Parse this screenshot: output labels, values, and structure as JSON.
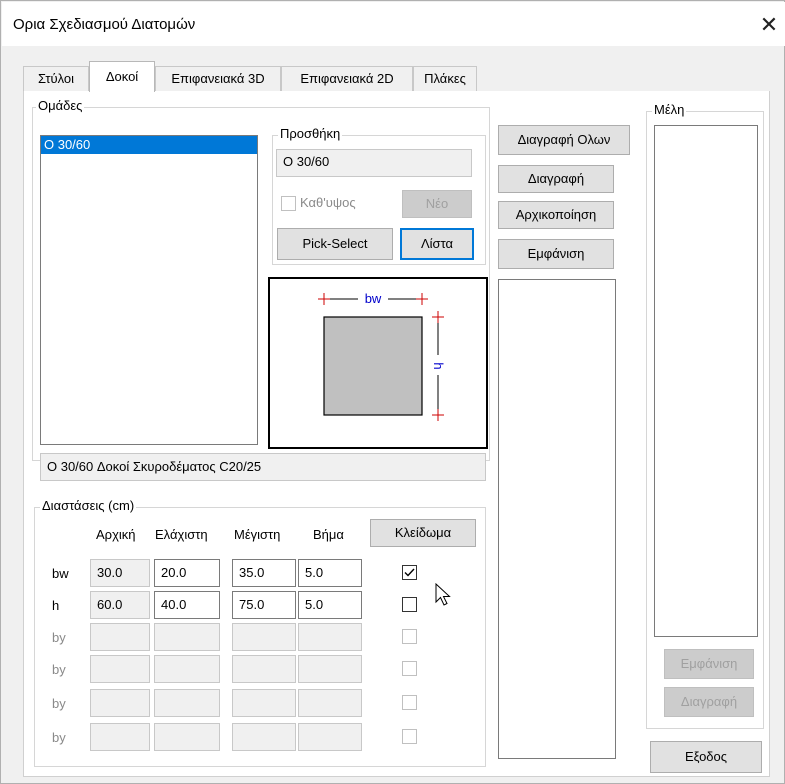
{
  "window": {
    "title": "Ορια Σχεδιασμού Διατομών",
    "close_glyph": "✕"
  },
  "tabs": [
    {
      "label": "Στύλοι",
      "active": false
    },
    {
      "label": "Δοκοί",
      "active": true
    },
    {
      "label": "Επιφανειακά 3D",
      "active": false
    },
    {
      "label": "Επιφανειακά 2D",
      "active": false
    },
    {
      "label": "Πλάκες",
      "active": false
    }
  ],
  "groups": {
    "label": "Ομάδες",
    "items": [
      "O 30/60"
    ],
    "description": "O 30/60 Δοκοί Σκυροδέματος C20/25"
  },
  "add": {
    "label": "Προσθήκη",
    "value": "O 30/60",
    "checkbox_label": "Καθ'υψος",
    "new_button": "Νέο",
    "pick_button": "Pick-Select",
    "list_button": "Λίστα"
  },
  "section_labels": {
    "bw": "bw",
    "h": "h"
  },
  "actions": {
    "delete_all": "Διαγραφή Ολων",
    "delete": "Διαγραφή",
    "initialize": "Αρχικοποίηση",
    "show": "Εμφάνιση"
  },
  "members": {
    "label": "Μέλη",
    "show_button": "Εμφάνιση",
    "delete_button": "Διαγραφή"
  },
  "dimensions": {
    "label": "Διαστάσεις (cm)",
    "headers": [
      "Αρχική",
      "Ελάχιστη",
      "Μέγιστη",
      "Βήμα"
    ],
    "lock_button": "Κλείδωμα",
    "rows": [
      {
        "label": "bw",
        "initial": "30.0",
        "min": "20.0",
        "max": "35.0",
        "step": "5.0",
        "locked": true,
        "enabled": true
      },
      {
        "label": "h",
        "initial": "60.0",
        "min": "40.0",
        "max": "75.0",
        "step": "5.0",
        "locked": false,
        "enabled": true
      },
      {
        "label": "by",
        "initial": "",
        "min": "",
        "max": "",
        "step": "",
        "locked": false,
        "enabled": false
      },
      {
        "label": "by",
        "initial": "",
        "min": "",
        "max": "",
        "step": "",
        "locked": false,
        "enabled": false
      },
      {
        "label": "by",
        "initial": "",
        "min": "",
        "max": "",
        "step": "",
        "locked": false,
        "enabled": false
      },
      {
        "label": "by",
        "initial": "",
        "min": "",
        "max": "",
        "step": "",
        "locked": false,
        "enabled": false
      }
    ]
  },
  "exit_button": "Εξοδος",
  "icons": {
    "cursor": "mouse-pointer-icon"
  },
  "colors": {
    "selection": "#0078d7",
    "dim_line": "#cc0000",
    "dim_text": "#0000cc",
    "section_fill": "#c0c0c0"
  }
}
